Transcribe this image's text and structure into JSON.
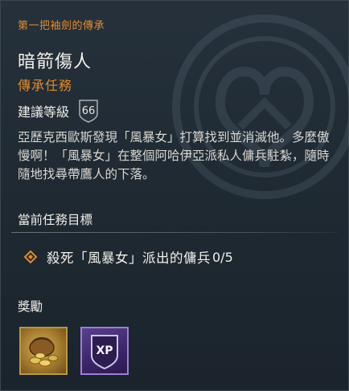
{
  "quest": {
    "legacy_label": "第一把袖劍的傳承",
    "title": "暗箭傷人",
    "type": "傳承任務",
    "level_label": "建議等級",
    "level_value": "66",
    "description": "亞歷克西歐斯發現「風暴女」打算找到並消滅他。多麼傲慢啊！「風暴女」在整個阿哈伊亞派私人傭兵駐紮，隨時隨地找尋帶鷹人的下落。"
  },
  "objectives": {
    "header": "當前任務目標",
    "items": [
      {
        "text": "殺死「風暴女」派出的傭兵",
        "progress": "0/5"
      }
    ]
  },
  "rewards": {
    "header": "獎勵",
    "items": [
      {
        "icon": "drachmae-pouch-icon"
      },
      {
        "icon": "xp-icon",
        "label": "XP"
      }
    ]
  },
  "colors": {
    "accent_orange": "#e08b30",
    "background": "#1f2830",
    "xp_purple": "#4a3279",
    "gold_border": "#b9993f"
  }
}
